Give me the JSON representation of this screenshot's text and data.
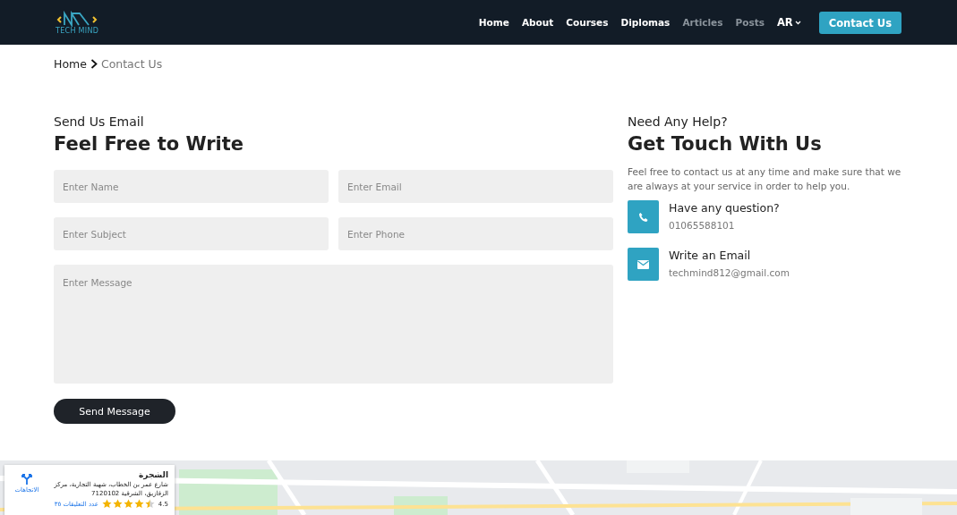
{
  "navbar": {
    "logo_text": "TECH MIND",
    "links": [
      {
        "label": "Home",
        "selected": false,
        "dimmed": false
      },
      {
        "label": "About",
        "selected": false,
        "dimmed": false
      },
      {
        "label": "Courses",
        "selected": false,
        "dimmed": false
      },
      {
        "label": "Diplomas",
        "selected": false,
        "dimmed": false
      },
      {
        "label": "Articles",
        "selected": false,
        "dimmed": true
      },
      {
        "label": "Posts",
        "selected": false,
        "dimmed": true
      }
    ],
    "language": "AR",
    "cta": "Contact Us"
  },
  "breadcrumb": [
    "Home",
    "Contact Us"
  ],
  "form": {
    "subtitle": "Send Us Email",
    "title": "Feel Free to Write",
    "fields": [
      {
        "placeholder": "Enter Name"
      },
      {
        "placeholder": "Enter Email"
      },
      {
        "placeholder": "Enter Subject"
      },
      {
        "placeholder": "Enter Phone"
      }
    ],
    "message": {
      "placeholder": "Enter Message"
    },
    "submit": "Send Message"
  },
  "help": {
    "subtitle": "Need Any Help?",
    "title": "Get Touch With Us",
    "text": "Feel free to contact us at any time and make sure that we are always at your service in order to help you.",
    "items": [
      {
        "kind": "phone",
        "label": "Have any question?",
        "value": "01065588101"
      },
      {
        "kind": "email",
        "label": "Write an Email",
        "value": "techmind812@gmail.com"
      }
    ]
  },
  "map": {
    "kind": "picture",
    "place_card": {
      "name": "الشجرة",
      "address": "شارع عمر بن الخطاب، شهبة التجارية، مركز الزقازيق، الشرقية 7120102",
      "rating": "4.5",
      "stars": 4.5,
      "reviews": "عدد التعليقات ٣٥",
      "directions": "الاتجاهات"
    }
  }
}
